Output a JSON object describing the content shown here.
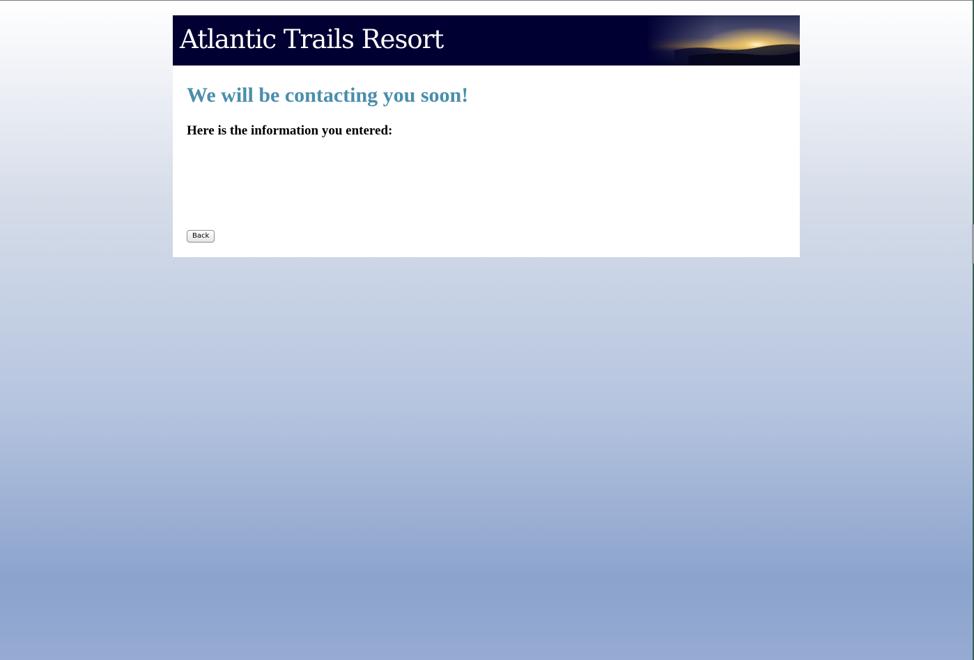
{
  "site": {
    "title": "Atlantic Trails Resort"
  },
  "main": {
    "heading": "We will be contacting you soon!",
    "subheading": "Here is the information you entered:",
    "back_label": "Back"
  },
  "colors": {
    "header_bg": "#000033",
    "heading": "#4a8eab",
    "page_bg_top": "#ffffff",
    "page_bg_bottom": "#8ba3cd"
  },
  "icons": {
    "header_image": "sunset-coast-image"
  }
}
